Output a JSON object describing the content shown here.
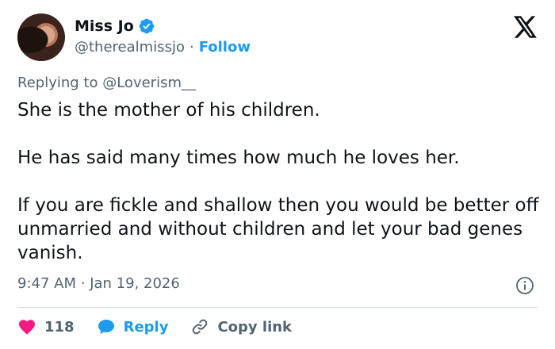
{
  "author": {
    "name": "Miss Jo",
    "handle": "@therealmissjo",
    "separator": "·",
    "follow_label": "Follow"
  },
  "reply_context": {
    "prefix": "Replying to",
    "mention": "@Loverism__"
  },
  "tweet": {
    "paragraphs": [
      "She is the mother of his children.",
      "He has said many times how much he loves her.",
      "If you are fickle and shallow then you would be better off unmarried and without children and let your bad genes vanish."
    ]
  },
  "meta": {
    "time": "9:47 AM",
    "separator": "·",
    "date": "Jan 19, 2026"
  },
  "actions": {
    "likes_count": "118",
    "reply_label": "Reply",
    "copy_link_label": "Copy link"
  },
  "colors": {
    "accent": "#1d9bf0",
    "like": "#f91880",
    "muted": "#536471",
    "text": "#0f1419"
  },
  "icons": {
    "verified": "verified-badge-icon",
    "logo": "x-logo-icon",
    "info": "info-icon",
    "like": "heart-icon",
    "reply": "speech-bubble-icon",
    "copy": "link-icon"
  }
}
